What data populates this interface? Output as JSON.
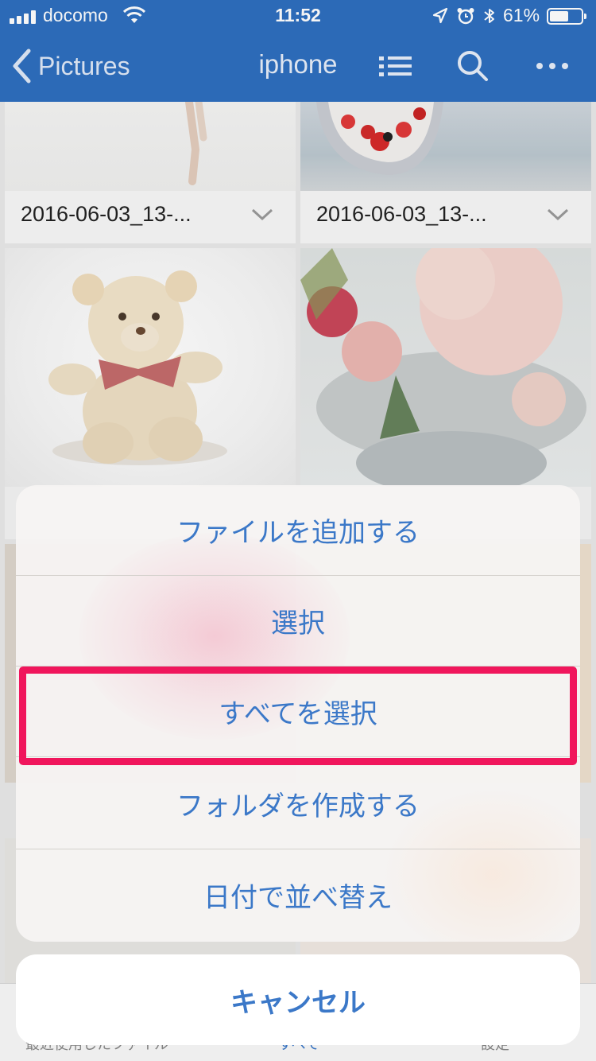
{
  "status_bar": {
    "carrier": "docomo",
    "time": "11:52",
    "battery_percent": "61%",
    "battery_level": 0.61,
    "icons": [
      "signal-icon",
      "wifi-icon",
      "location-icon",
      "alarm-icon",
      "bluetooth-icon",
      "battery-icon"
    ]
  },
  "nav": {
    "back_label": "Pictures",
    "title": "iphone",
    "icons": [
      "back-chevron-icon",
      "list-view-icon",
      "search-icon",
      "more-icon"
    ],
    "bar_color": "#2e6fbf"
  },
  "grid": {
    "captions": [
      "2016-06-03_13-...",
      "2016-06-03_13-..."
    ]
  },
  "tabbar": {
    "items": [
      "最近使用したファイル",
      "すべて",
      "設定"
    ]
  },
  "action_sheet": {
    "actions": [
      "ファイルを追加する",
      "選択",
      "すべてを選択",
      "フォルダを作成する",
      "日付で並べ替え"
    ],
    "cancel_label": "キャンセル",
    "highlighted_action": "すべてを選択",
    "text_color": "#3b78c8",
    "highlight_color": "#f0165c"
  }
}
